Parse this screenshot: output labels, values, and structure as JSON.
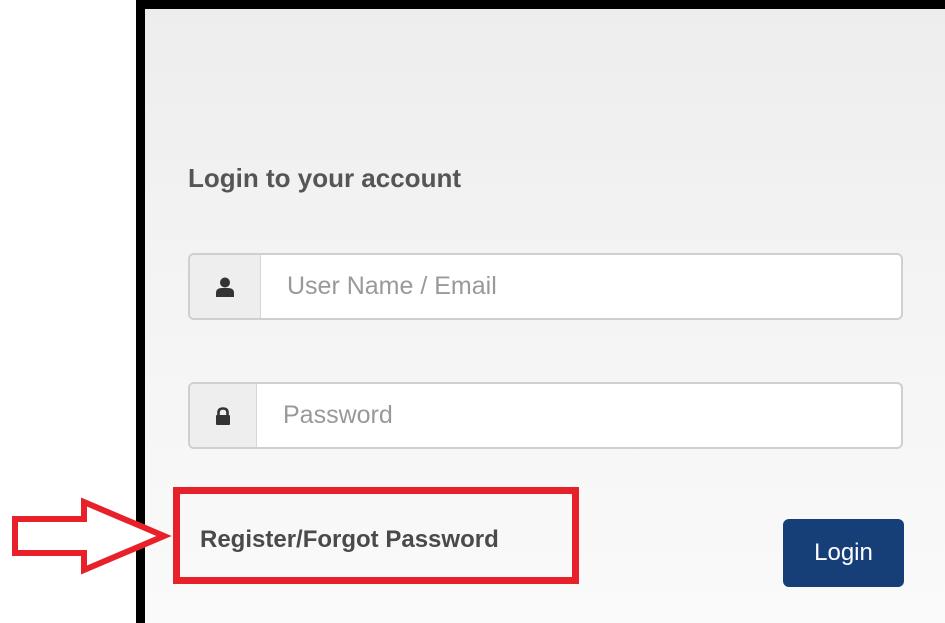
{
  "login": {
    "title": "Login to your account",
    "username_placeholder": "User Name / Email",
    "password_placeholder": "Password",
    "register_link": "Register/Forgot Password",
    "login_button": "Login"
  },
  "icons": {
    "username": "user-icon",
    "password": "lock-icon",
    "annotation": "arrow-right-icon"
  },
  "colors": {
    "button": "#163f78",
    "annotation": "#e8202a",
    "title": "#555555"
  }
}
